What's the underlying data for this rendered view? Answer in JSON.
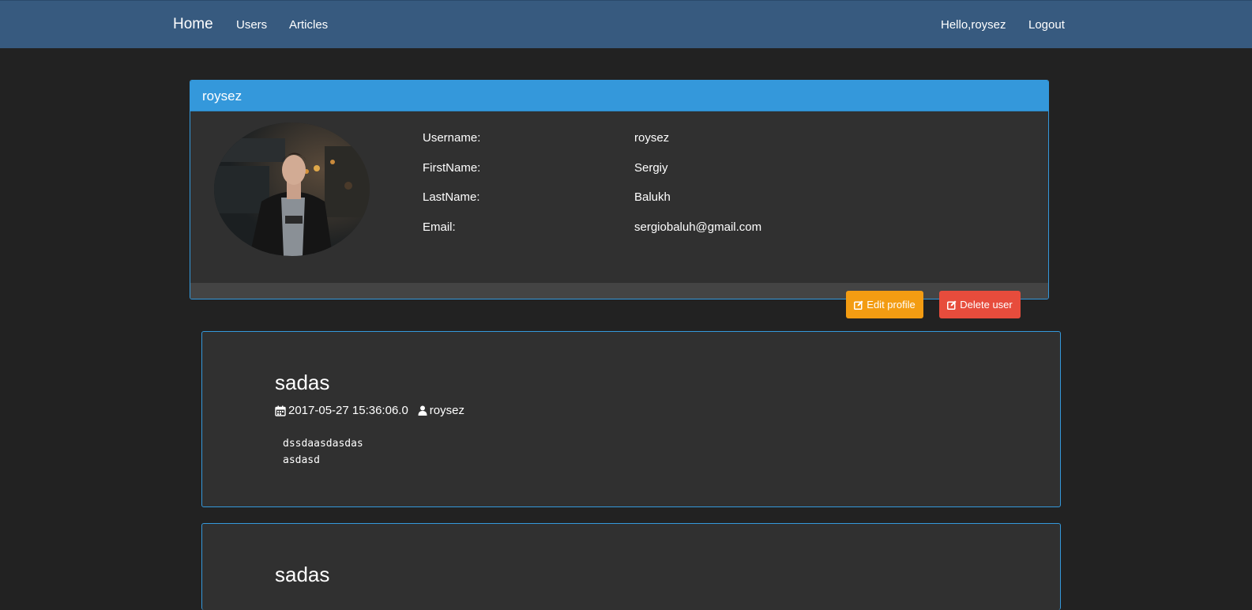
{
  "nav": {
    "brand": "Home",
    "links": [
      "Users",
      "Articles"
    ],
    "greeting": "Hello,roysez",
    "logout": "Logout"
  },
  "profile": {
    "heading": "roysez",
    "avatar_alt": "user-photo",
    "fields": [
      {
        "label": "Username:",
        "value": "roysez"
      },
      {
        "label": "FirstName:",
        "value": "Sergiy"
      },
      {
        "label": "LastName:",
        "value": "Balukh"
      },
      {
        "label": "Email:",
        "value": "sergiobaluh@gmail.com"
      }
    ],
    "edit_button": "Edit profile",
    "delete_button": "Delete user"
  },
  "articles": [
    {
      "title": "sadas",
      "date": "2017-05-27 15:36:06.0",
      "author": "roysez",
      "body": "dssdaasdasdas\nasdasd"
    },
    {
      "title": "sadas"
    }
  ],
  "colors": {
    "background": "#222222",
    "navbar": "#375a7f",
    "primary": "#3498db",
    "warning": "#f39c12",
    "danger": "#e74c3c",
    "panel": "#303030"
  },
  "icons": {
    "edit": "edit-icon",
    "delete": "edit-icon",
    "date": "calendar-icon",
    "author": "user-icon"
  }
}
